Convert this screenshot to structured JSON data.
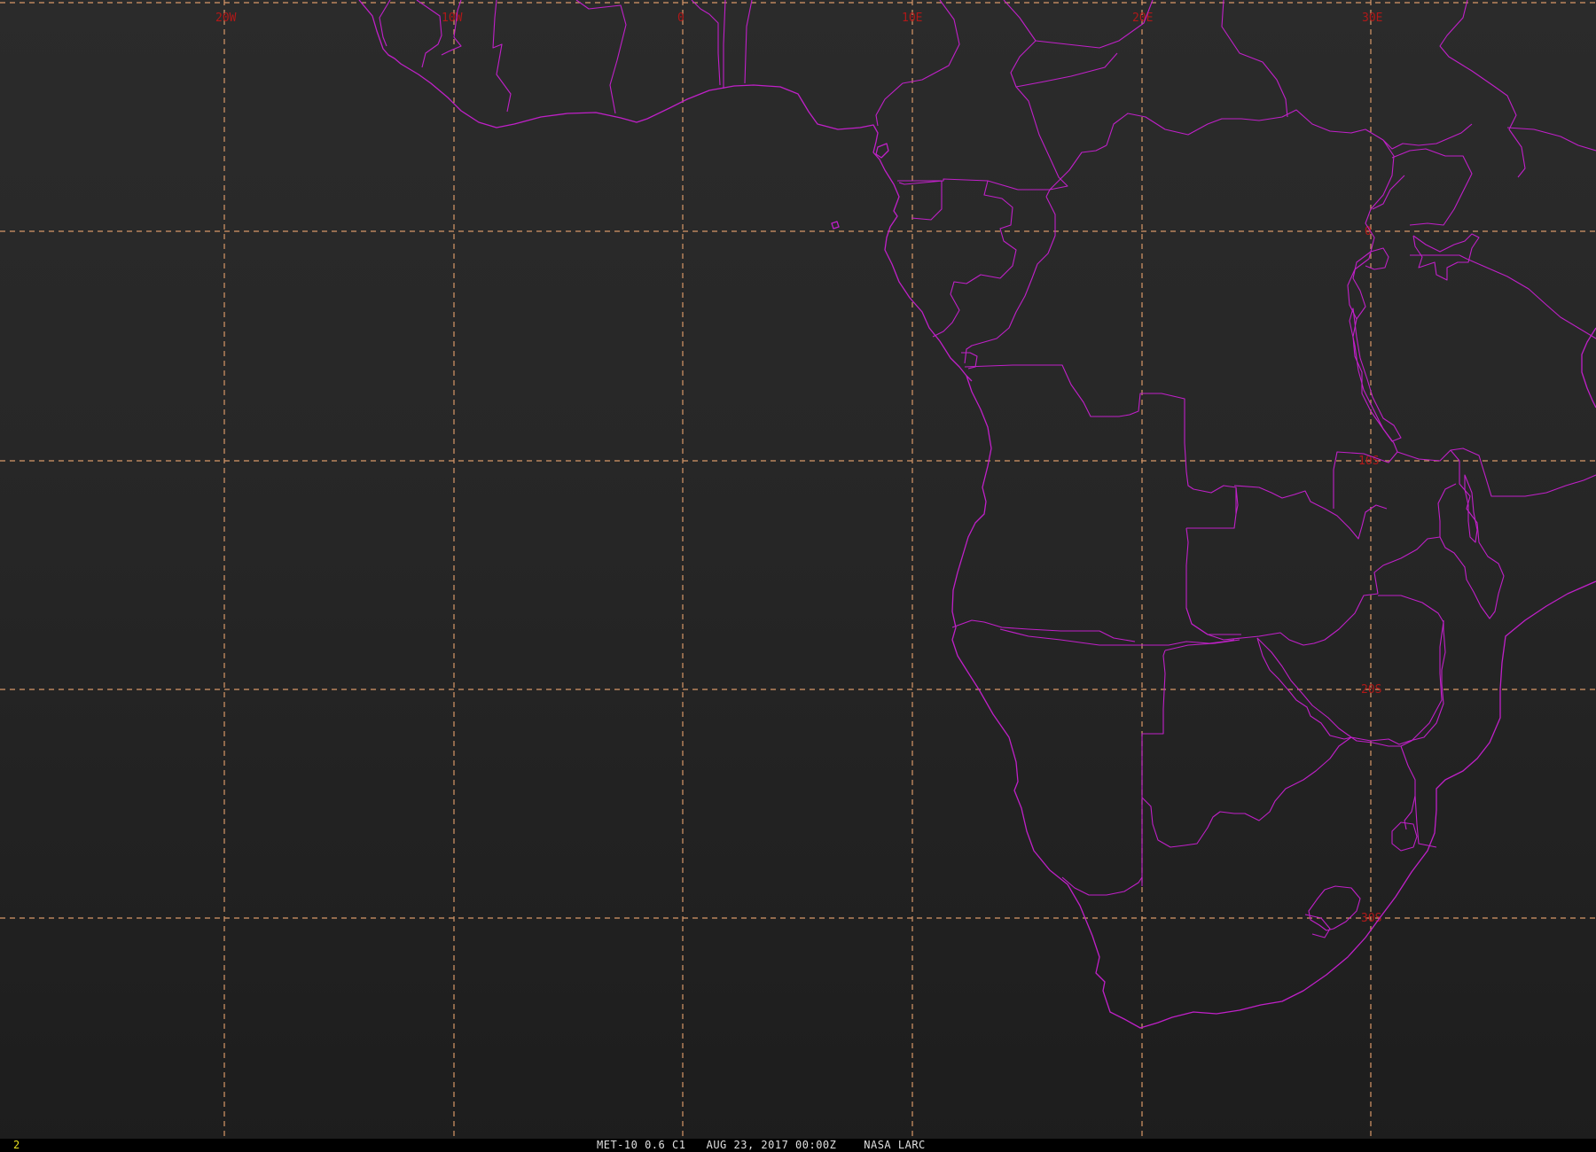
{
  "map": {
    "longitude_labels": [
      "20W",
      "10W",
      "0",
      "10E",
      "20E",
      "30E"
    ],
    "latitude_labels": [
      "0",
      "10S",
      "20S",
      "30S"
    ],
    "colors": {
      "background": "#262626",
      "coastlines": "#c020c8",
      "graticule": "#d89868",
      "graticule_labels": "#b01818"
    }
  },
  "status_bar": {
    "frame_number": "2",
    "info": "MET-10 0.6 C1   AUG 23, 2017 00:00Z    NASA LARC"
  }
}
